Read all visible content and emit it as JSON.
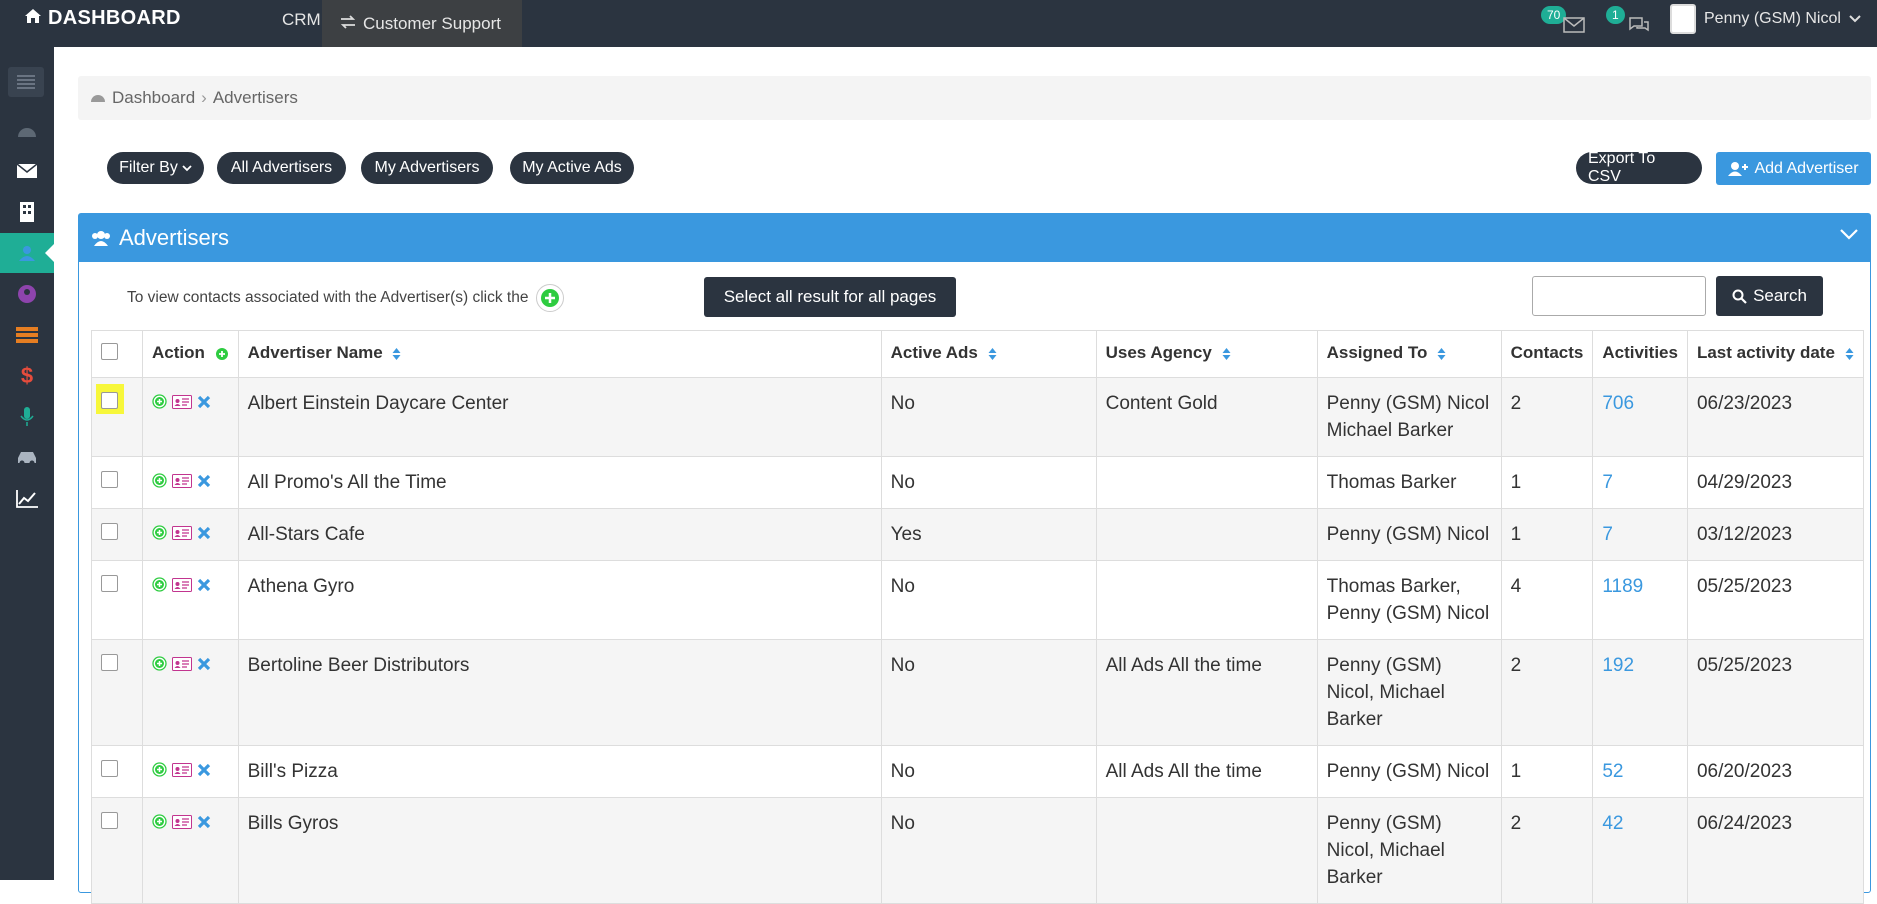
{
  "topbar": {
    "brand": "DASHBOARD",
    "nav_crm": "CRM",
    "nav_customer_support": "Customer Support",
    "mail_count": "70",
    "chat_count": "1",
    "user_name": "Penny (GSM) Nicol"
  },
  "breadcrumb": {
    "home": "Dashboard",
    "current": "Advertisers"
  },
  "filters": {
    "filter_by": "Filter By",
    "all": "All Advertisers",
    "mine": "My Advertisers",
    "active_ads": "My Active Ads",
    "export": "Export To CSV",
    "add": "Add Advertiser"
  },
  "panel": {
    "title": "Advertisers",
    "hint": "To view contacts associated with the Advertiser(s) click the",
    "select_all": "Select all result for all pages",
    "search_value": "",
    "search_label": "Search"
  },
  "table": {
    "headers": {
      "action": "Action",
      "name": "Advertiser Name",
      "active_ads": "Active Ads",
      "agency": "Uses Agency",
      "assigned": "Assigned To",
      "contacts": "Contacts",
      "activities": "Activities",
      "last": "Last activity date"
    },
    "rows": [
      {
        "name": "Albert Einstein Daycare Center",
        "active_ads": "No",
        "agency": "Content Gold",
        "assigned": "Penny (GSM) Nicol Michael Barker",
        "contacts": "2",
        "activities": "706",
        "last": "06/23/2023"
      },
      {
        "name": "All Promo's All the Time",
        "active_ads": "No",
        "agency": "",
        "assigned": "Thomas Barker",
        "contacts": "1",
        "activities": "7",
        "last": "04/29/2023"
      },
      {
        "name": "All-Stars Cafe",
        "active_ads": "Yes",
        "agency": "",
        "assigned": "Penny (GSM) Nicol",
        "contacts": "1",
        "activities": "7",
        "last": "03/12/2023"
      },
      {
        "name": "Athena Gyro",
        "active_ads": "No",
        "agency": "",
        "assigned": "Thomas Barker, Penny (GSM) Nicol",
        "contacts": "4",
        "activities": "1189",
        "last": "05/25/2023"
      },
      {
        "name": "Bertoline Beer Distributors",
        "active_ads": "No",
        "agency": "All Ads All the time",
        "assigned": "Penny (GSM) Nicol, Michael Barker",
        "contacts": "2",
        "activities": "192",
        "last": "05/25/2023"
      },
      {
        "name": "Bill's Pizza",
        "active_ads": "No",
        "agency": "All Ads All the time",
        "assigned": "Penny (GSM) Nicol",
        "contacts": "1",
        "activities": "52",
        "last": "06/20/2023"
      },
      {
        "name": "Bills Gyros",
        "active_ads": "No",
        "agency": "",
        "assigned": "Penny (GSM) Nicol, Michael Barker",
        "contacts": "2",
        "activities": "42",
        "last": "06/24/2023"
      }
    ]
  },
  "colors": {
    "dark": "#2b3440",
    "blue": "#3a98df",
    "teal": "#1fae96",
    "highlight": "#f7f73a"
  }
}
